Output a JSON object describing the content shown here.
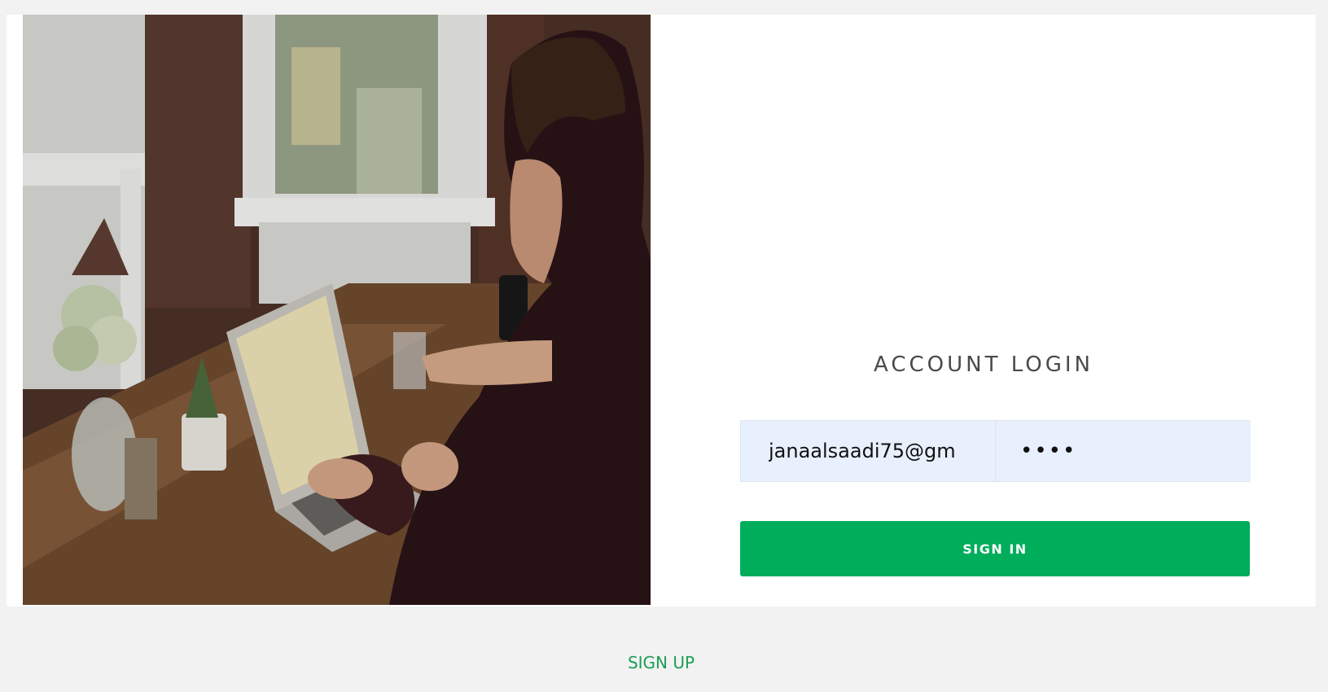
{
  "login": {
    "title": "ACCOUNT LOGIN",
    "email_value": "janaalsaadi75@gm",
    "password_value": "••••",
    "signin_label": "SIGN IN"
  },
  "footer": {
    "signup_label": "SIGN UP"
  },
  "colors": {
    "accent": "#00ad5b",
    "input_bg": "#e8f0fe",
    "page_bg": "#f2f2f2"
  }
}
